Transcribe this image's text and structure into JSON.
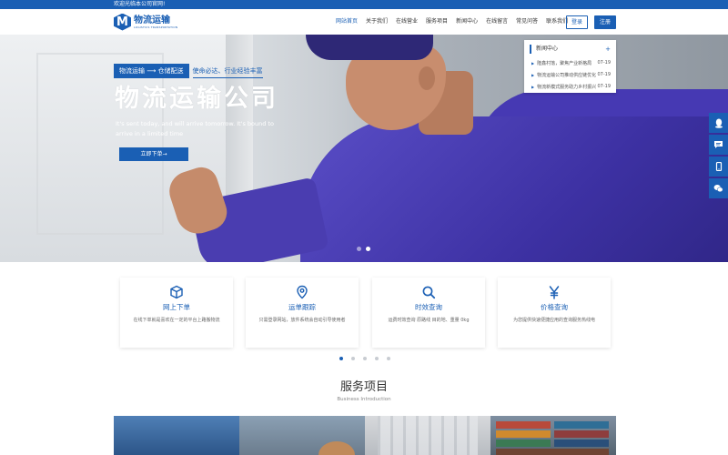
{
  "topbar": {
    "welcome": "欢迎光临本公司官网!"
  },
  "header": {
    "logo_letter": "M",
    "logo_name": "物流运输",
    "logo_sub": "LOGISTICS TRANSPORTATION",
    "nav": [
      "网站首页",
      "关于我们",
      "在线营业",
      "服务项目",
      "新闻中心",
      "在线留言",
      "常见问答",
      "联系我们"
    ],
    "login": "登录",
    "register": "注册"
  },
  "hero": {
    "tag": "物流运输 ⟶ 仓储配送",
    "motto": "使命必达、行业经验丰富",
    "title": "物流运输公司",
    "desc": "It's sent today, and will arrive tomorrow. It's bound to arrive in a limited time",
    "button": "立即下单→",
    "slides": 2,
    "active_slide": 1
  },
  "news": {
    "title": "新闻中心",
    "more": "+",
    "items": [
      {
        "title": "隆鑫村落，聚焦产业新格局",
        "date": "07-19"
      },
      {
        "title": "物流运输公司推动供应链优化",
        "date": "07-19"
      },
      {
        "title": "物流新模式服务助力乡村振兴",
        "date": "07-19"
      }
    ]
  },
  "side_tools": [
    "qq-icon",
    "message-icon",
    "phone-icon",
    "wechat-icon"
  ],
  "services": {
    "cards": [
      {
        "icon": "cube-icon",
        "title": "网上下单",
        "desc": "在线下单就是喜欢在一定的平台上路搬物流"
      },
      {
        "icon": "location-icon",
        "title": "运单跟踪",
        "desc": "只需登录网站，放件系统会自动引导使用者"
      },
      {
        "icon": "search-icon",
        "title": "时效查询",
        "desc": "运费时效查询 原路线 目的地、重量 0kg"
      },
      {
        "icon": "yen-icon",
        "title": "价格查询",
        "desc": "为您提供快速便捷应用的查询服务热线电"
      }
    ],
    "dots": 5,
    "active_dot": 0
  },
  "section": {
    "title": "服务项目",
    "subtitle": "Business Introduction"
  },
  "colors": {
    "primary": "#1a5fb4"
  }
}
